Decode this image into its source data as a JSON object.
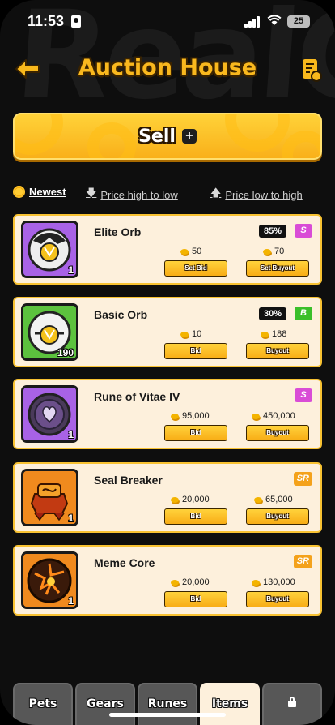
{
  "status_bar": {
    "time": "11:53",
    "battery": "25",
    "icons": [
      "id-card-icon",
      "signal-icon",
      "wifi-icon",
      "battery-icon"
    ]
  },
  "header": {
    "title": "Auction House",
    "watermark": "RealGo",
    "back_icon": "arrow-left-icon",
    "history_icon": "listing-history-icon"
  },
  "sell": {
    "label": "Sell",
    "icon": "plus-icon"
  },
  "sort": {
    "newest": "Newest",
    "price_high_to_low": "Price high to low",
    "price_low_to_high": "Price low to high",
    "active": "newest"
  },
  "listings": [
    {
      "name": "Elite Orb",
      "quantity": "1",
      "percent": "85%",
      "rarity": "S",
      "rarity_color": "#d94cd6",
      "bid_price": "50",
      "buyout_price": "70",
      "bid_label": "Set Bid",
      "buyout_label": "Set Buyout"
    },
    {
      "name": "Basic Orb",
      "quantity": "190",
      "percent": "30%",
      "rarity": "B",
      "rarity_color": "#3bbf2a",
      "bid_price": "10",
      "buyout_price": "188",
      "bid_label": "Bid",
      "buyout_label": "Buyout"
    },
    {
      "name": "Rune of Vitae IV",
      "quantity": "1",
      "rarity": "S",
      "rarity_color": "#d94cd6",
      "bid_price": "95,000",
      "buyout_price": "450,000",
      "bid_label": "Bid",
      "buyout_label": "Buyout"
    },
    {
      "name": "Seal Breaker",
      "quantity": "1",
      "rarity": "SR",
      "rarity_color": "#f4a21b",
      "bid_price": "20,000",
      "buyout_price": "65,000",
      "bid_label": "Bid",
      "buyout_label": "Buyout"
    },
    {
      "name": "Meme Core",
      "quantity": "1",
      "rarity": "SR",
      "rarity_color": "#f4a21b",
      "bid_price": "20,000",
      "buyout_price": "130,000",
      "bid_label": "Bid",
      "buyout_label": "Buyout"
    }
  ],
  "tabs": [
    {
      "label": "Pets"
    },
    {
      "label": "Gears"
    },
    {
      "label": "Runes"
    },
    {
      "label": "Items"
    },
    {
      "label": "",
      "icon": "lock-icon"
    }
  ],
  "active_tab": "Items",
  "colors": {
    "accent": "#f9b81e",
    "card_bg": "#fdf0dc",
    "card_border": "#f8c232",
    "background": "#0e0e0e"
  }
}
